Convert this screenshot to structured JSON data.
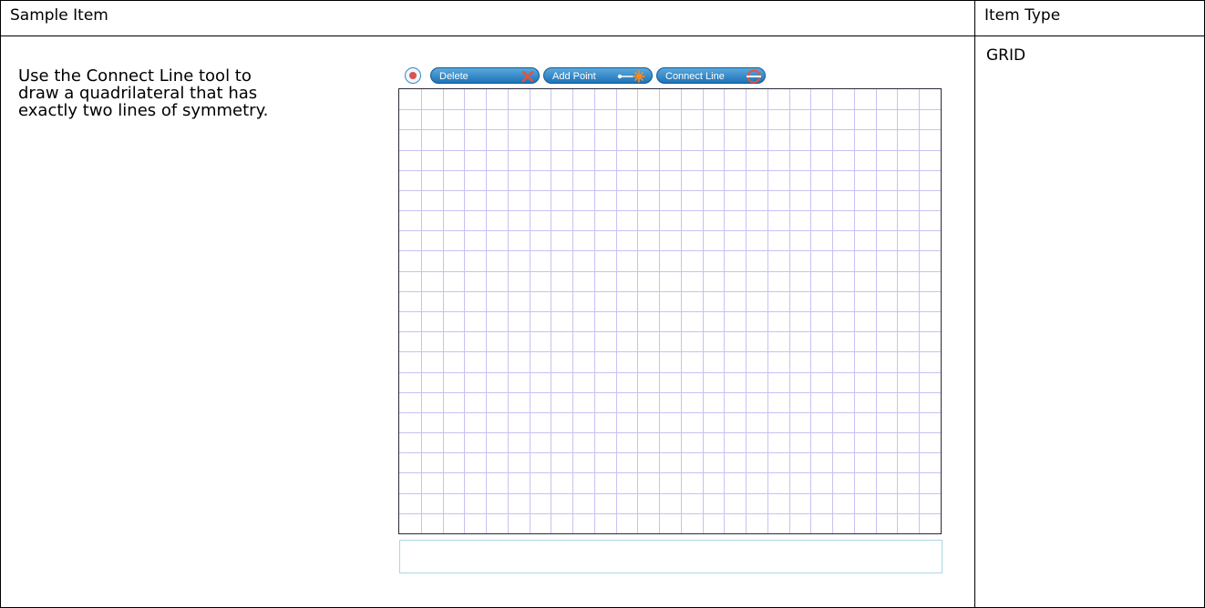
{
  "table": {
    "header_left": "Sample Item",
    "header_right": "Item Type",
    "item_type": "GRID"
  },
  "prompt": {
    "lines": [
      "Use the Connect Line tool to",
      "draw a quadrilateral that has",
      "exactly two lines of symmetry."
    ]
  },
  "toolbar": {
    "reset_icon": "reset-icon",
    "delete_label": "Delete",
    "delete_icon": "x-icon",
    "add_point_label": "Add Point",
    "add_point_icon": "point-star-icon",
    "connect_line_label": "Connect Line",
    "connect_line_icon": "connect-line-icon"
  },
  "grid": {
    "columns": 25,
    "rows": 22,
    "line_color": "#c7c2f2",
    "border_color": "#2a2a3a"
  },
  "answer_box": {
    "value": ""
  },
  "colors": {
    "button_top": "#5aa9dc",
    "button_bottom": "#1e73b8",
    "delete_x": "#e5533d",
    "answer_border": "#a9d8e6"
  }
}
